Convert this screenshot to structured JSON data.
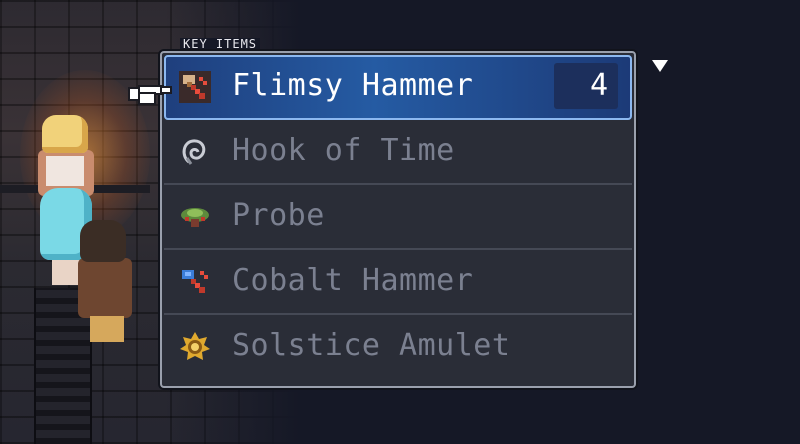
{
  "menu": {
    "label": "KEY ITEMS",
    "items": [
      {
        "name": "Flimsy Hammer",
        "quantity": "4",
        "icon": "hammer-icon",
        "selected": true
      },
      {
        "name": "Hook of Time",
        "icon": "hook-icon",
        "selected": false
      },
      {
        "name": "Probe",
        "icon": "probe-icon",
        "selected": false
      },
      {
        "name": "Cobalt Hammer",
        "icon": "cobalt-hammer-icon",
        "selected": false
      },
      {
        "name": "Solstice Amulet",
        "icon": "amulet-icon",
        "selected": false
      }
    ]
  },
  "colors": {
    "selected_row": "#255ba3",
    "panel": "#2a2d37",
    "text_dim": "#7b8090",
    "text_active": "#ffffff"
  }
}
